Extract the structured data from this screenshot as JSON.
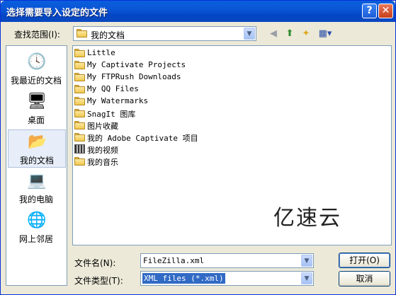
{
  "window": {
    "title": "选择需要导入设定的文件"
  },
  "titlebar": {
    "help": "?",
    "close": "✕"
  },
  "lookin": {
    "label": "查找范围(I):",
    "value": "我的文档"
  },
  "places": [
    {
      "label": "我最近的文档",
      "icon": "recent-documents-icon"
    },
    {
      "label": "桌面",
      "icon": "desktop-icon"
    },
    {
      "label": "我的文档",
      "icon": "my-documents-icon",
      "selected": true
    },
    {
      "label": "我的电脑",
      "icon": "my-computer-icon"
    },
    {
      "label": "网上邻居",
      "icon": "network-places-icon"
    }
  ],
  "files": [
    {
      "name": "Little",
      "type": "folder"
    },
    {
      "name": "My Captivate Projects",
      "type": "folder"
    },
    {
      "name": "My FTPRush Downloads",
      "type": "folder"
    },
    {
      "name": "My QQ Files",
      "type": "folder"
    },
    {
      "name": "My Watermarks",
      "type": "folder"
    },
    {
      "name": "SnagIt 图库",
      "type": "folder"
    },
    {
      "name": "图片收藏",
      "type": "folder"
    },
    {
      "name": "我的 Adobe Captivate 项目",
      "type": "folder"
    },
    {
      "name": "我的视频",
      "type": "video-folder"
    },
    {
      "name": "我的音乐",
      "type": "folder"
    }
  ],
  "watermark": "亿速云",
  "filename": {
    "label": "文件名(N):",
    "value": "FileZilla.xml"
  },
  "filetype": {
    "label": "文件类型(T):",
    "value": "XML files (*.xml)"
  },
  "buttons": {
    "open": "打开(O)",
    "cancel": "取消"
  }
}
